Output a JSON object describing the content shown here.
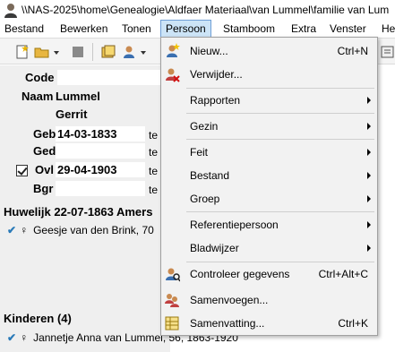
{
  "window": {
    "title": "\\\\NAS-2025\\home\\Genealogie\\Aldfaer Materiaal\\van Lummel\\familie van Lum"
  },
  "menubar": {
    "items": [
      "Bestand",
      "Bewerken",
      "Tonen",
      "Persoon",
      "Stamboom",
      "Extra",
      "Venster",
      "He"
    ],
    "active": "Persoon"
  },
  "form": {
    "code_label": "Code",
    "naam_label": "Naam",
    "naam_value": "Lummel",
    "voornaam_value": "Gerrit",
    "geb_label": "Geb",
    "geb_date": "14-03-1833",
    "geb_suffix": "te",
    "ged_label": "Ged",
    "ged_suffix": "te",
    "ovl_label": "Ovl",
    "ovl_date": "29-04-1903",
    "ovl_suffix": "te",
    "bgr_label": "Bgr",
    "bgr_suffix": "te"
  },
  "huwelijk": {
    "header": "Huwelijk 22-07-1863 Amers",
    "partner": "Geesje van den Brink, 70"
  },
  "kinderen": {
    "header": "Kinderen (4)",
    "child": "Jannetje Anna van Lummel, 56, 1863-1920"
  },
  "persoon_menu": {
    "items": [
      {
        "label": "Nieuw...",
        "shortcut": "Ctrl+N",
        "icon": "new-person-icon"
      },
      {
        "label": "Verwijder...",
        "shortcut": "",
        "icon": "delete-person-icon"
      },
      {
        "label": "Rapporten",
        "submenu": true
      },
      {
        "label": "Gezin",
        "submenu": true
      },
      {
        "label": "Feit",
        "submenu": true
      },
      {
        "label": "Bestand",
        "submenu": true
      },
      {
        "label": "Groep",
        "submenu": true
      },
      {
        "label": "Referentiepersoon",
        "submenu": true
      },
      {
        "label": "Bladwijzer",
        "submenu": true
      },
      {
        "label": "Controleer gegevens",
        "shortcut": "Ctrl+Alt+C",
        "icon": "check-person-icon"
      },
      {
        "label": "Samenvoegen...",
        "shortcut": "",
        "icon": "merge-persons-icon"
      },
      {
        "label": "Samenvatting...",
        "shortcut": "Ctrl+K",
        "icon": "summary-icon"
      }
    ]
  }
}
